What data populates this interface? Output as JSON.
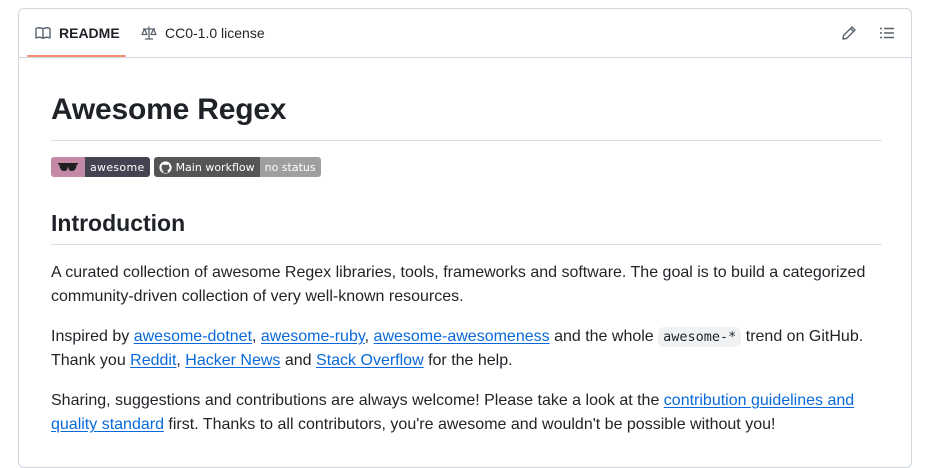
{
  "tabs": {
    "readme": "README",
    "license": "CC0-1.0 license"
  },
  "toolbar": {
    "edit_icon": "pencil-icon",
    "outline_icon": "list-unordered-icon"
  },
  "readme": {
    "title": "Awesome Regex",
    "badges": [
      {
        "left_icon": "sunglasses-icon",
        "right": "awesome",
        "colors": [
          "#c38aa7",
          "#434351"
        ]
      },
      {
        "left_icon": "github-mark-icon",
        "left": "Main workflow",
        "right": "no status",
        "colors": [
          "#555555",
          "#9f9f9f"
        ]
      }
    ],
    "section_heading": "Introduction",
    "p1": {
      "text": "A curated collection of awesome Regex libraries, tools, frameworks and software. The goal is to build a categorized community-driven collection of very well-known resources."
    },
    "p2": {
      "t1": "Inspired by ",
      "link_dotnet": "awesome-dotnet",
      "sep1": ", ",
      "link_ruby": "awesome-ruby",
      "sep2": ", ",
      "link_awesomeness": "awesome-awesomeness",
      "t2": " and the whole ",
      "code": "awesome-*",
      "t3": " trend on GitHub. Thank you ",
      "link_reddit": "Reddit",
      "sep3": ", ",
      "link_hn": "Hacker News",
      "t4": " and ",
      "link_so": "Stack Overflow",
      "t5": " for the help."
    },
    "p3": {
      "t1": "Sharing, suggestions and contributions are always welcome! Please take a look at the ",
      "link_guidelines": "contribution guidelines and quality standard",
      "t2": " first. Thanks to all contributors, you're awesome and wouldn't be possible without you!"
    }
  },
  "colors": {
    "link": "#0969da",
    "tab_underline": "#fd8c73",
    "border": "#d0d7de"
  }
}
